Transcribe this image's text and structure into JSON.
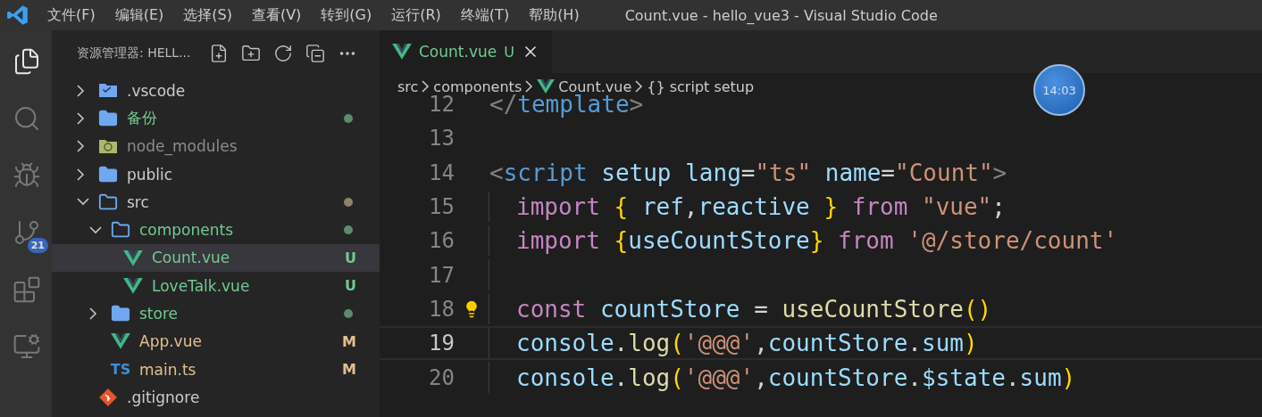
{
  "window": {
    "title": "Count.vue - hello_vue3 - Visual Studio Code"
  },
  "menu": [
    "文件(F)",
    "编辑(E)",
    "选择(S)",
    "查看(V)",
    "转到(G)",
    "运行(R)",
    "终端(T)",
    "帮助(H)"
  ],
  "activity_bar": [
    {
      "kind": "files",
      "selected": true
    },
    {
      "kind": "search",
      "selected": false
    },
    {
      "kind": "debug",
      "selected": false
    },
    {
      "kind": "scm",
      "selected": false,
      "badge": "21"
    },
    {
      "kind": "extensions",
      "selected": false
    },
    {
      "kind": "remote",
      "selected": false
    }
  ],
  "sidebar": {
    "title": "资源管理器: HELL...",
    "items": [
      {
        "name": ".vscode",
        "kind": "vscode",
        "expanded": false,
        "selected": false,
        "color": "#cccccc"
      },
      {
        "name": "备份",
        "kind": "folder",
        "expanded": false,
        "selected": false,
        "color": "#73c991",
        "dot": {
          "color": "#5e8a6e"
        }
      },
      {
        "name": "node_modules",
        "kind": "node",
        "expanded": false,
        "selected": false,
        "color": "#8c8c8c"
      },
      {
        "name": "public",
        "kind": "folder",
        "expanded": false,
        "selected": false,
        "color": "#cccccc"
      },
      {
        "name": "src",
        "kind": "folder",
        "expanded": true,
        "selected": false,
        "color": "#cccccc",
        "dot": {
          "color": "#8f8268"
        },
        "children": [
          {
            "name": "components",
            "kind": "folder",
            "expanded": true,
            "selected": false,
            "color": "#73c991",
            "dot": {
              "color": "#5e8a6e"
            },
            "children": [
              {
                "name": "Count.vue",
                "kind": "vue",
                "selected": true,
                "color": "#73c991",
                "status": "U"
              },
              {
                "name": "LoveTalk.vue",
                "kind": "vue",
                "selected": false,
                "color": "#73c991",
                "status": "U"
              }
            ]
          },
          {
            "name": "store",
            "kind": "folder",
            "expanded": false,
            "selected": false,
            "color": "#73c991",
            "dot": {
              "color": "#5e8a6e"
            }
          },
          {
            "name": "App.vue",
            "kind": "vue",
            "selected": false,
            "color": "#e2c08d",
            "status": "M"
          },
          {
            "name": "main.ts",
            "kind": "ts",
            "selected": false,
            "color": "#e2c08d",
            "status": "M",
            "icon_text": "TS"
          }
        ]
      },
      {
        "name": ".gitignore",
        "kind": "git",
        "selected": false,
        "color": "#cccccc"
      }
    ]
  },
  "tabs": [
    {
      "label": "Count.vue",
      "status": "U",
      "selected": true
    }
  ],
  "breadcrumbs": [
    "src",
    "components",
    "Count.vue",
    "{} script setup"
  ],
  "overlay_clock": "14:03",
  "code": [
    {
      "number": "12",
      "current": false,
      "text": "</template>"
    },
    {
      "number": "13",
      "current": false
    },
    {
      "number": "14",
      "current": false,
      "text": "<script setup lang=\"ts\" name=\"Count\">"
    },
    {
      "number": "15",
      "current": false,
      "indent": true,
      "text": "import { ref,reactive } from \"vue\";"
    },
    {
      "number": "16",
      "current": false,
      "indent": true,
      "text": "import {useCountStore} from '@/store/count'"
    },
    {
      "number": "17",
      "current": false,
      "indent": true
    },
    {
      "number": "18",
      "current": false,
      "indent": true,
      "bulb": true,
      "text": "const countStore = useCountStore()"
    },
    {
      "number": "19",
      "current": true,
      "indent": true,
      "text": "console.log('@@@',countStore.sum)"
    },
    {
      "number": "20",
      "current": false,
      "indent": true,
      "text": "console.log('@@@',countStore.$state.sum)"
    }
  ]
}
